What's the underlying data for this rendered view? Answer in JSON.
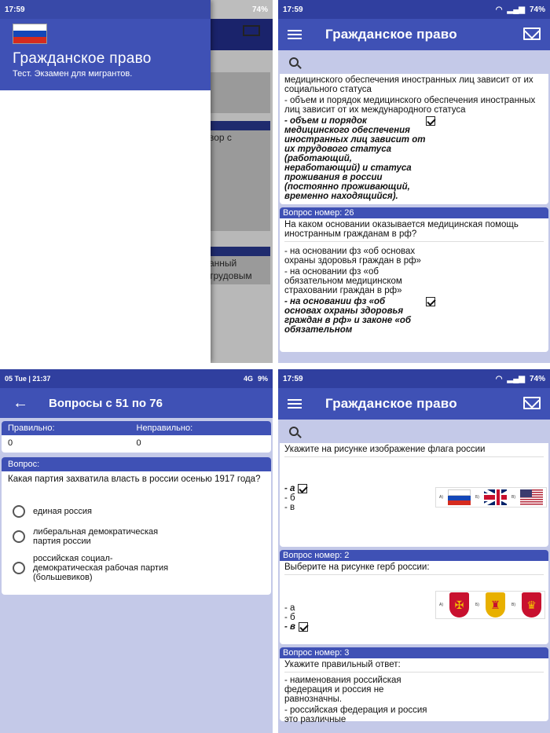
{
  "panel1": {
    "status": {
      "time": "17:59",
      "battery": "74%"
    },
    "drawer": {
      "title": "Гражданское право",
      "subtitle": "Тест. Экзамен для мигрантов."
    },
    "bg_snippets": [
      "вор с",
      "анный",
      "трудовым"
    ]
  },
  "panel2": {
    "status": {
      "time": "17:59",
      "battery": "74%"
    },
    "app_title": "Гражданское право",
    "card_top": {
      "lines_plain": [
        "медицинского обеспечения иностранных лиц зависит от их социального статуса",
        "- объем и порядок медицинского обеспечения иностранных лиц зависит от их международного статуса"
      ],
      "correct": "- объем и порядок медицинского обеспечения иностранных лиц зависит от их трудового статуса (работающий, неработающий) и статуса проживания в россии (постоянно проживающий, временно находящийся)."
    },
    "q26": {
      "header": "Вопрос номер: 26",
      "question": "На каком основании оказывается медицинская помощь иностранным гражданам в рф?",
      "opt1": "- на основании фз «об основах охраны здоровья граждан в рф»",
      "opt2": "- на основании фз «об обязательном медицинском страховании граждан в рф»",
      "correct": "- на основании фз «об основах охраны здоровья граждан в рф» и законе «об обязательном"
    }
  },
  "panel3": {
    "status": {
      "time": "05 Tue | 21:37",
      "network": "4G",
      "battery": "9%"
    },
    "title": "Вопросы с 51 по 76",
    "score": {
      "correct_label": "Правильно:",
      "wrong_label": "Неправильно:",
      "correct_value": "0",
      "wrong_value": "0"
    },
    "question_label": "Вопрос:",
    "question": "Какая партия захватила власть в россии осенью 1917 года?",
    "options": [
      "единая россия",
      "либеральная демократическая партия россии",
      "российская социал-демократическая рабочая партия (большевиков)"
    ]
  },
  "panel4": {
    "status": {
      "time": "17:59",
      "battery": "74%"
    },
    "app_title": "Гражданское право",
    "q1": {
      "question": "Укажите на рисунке изображение флага россии",
      "opts": [
        "- а",
        "- б",
        "- в"
      ],
      "correct_index": 0,
      "labels": [
        "А)",
        "Б)",
        "В)"
      ]
    },
    "q2": {
      "header": "Вопрос номер: 2",
      "question": "Выберите на рисунке герб россии:",
      "opts": [
        "- а",
        "- б",
        "- в"
      ],
      "correct_index": 2,
      "labels": [
        "А)",
        "Б)",
        "В)"
      ]
    },
    "q3": {
      "header": "Вопрос номер: 3",
      "question": "Укажите правильный ответ:",
      "opt1": "- наименования российская федерация и россия не равнозначны.",
      "opt2": "- российская федерация и россия это различные"
    }
  }
}
